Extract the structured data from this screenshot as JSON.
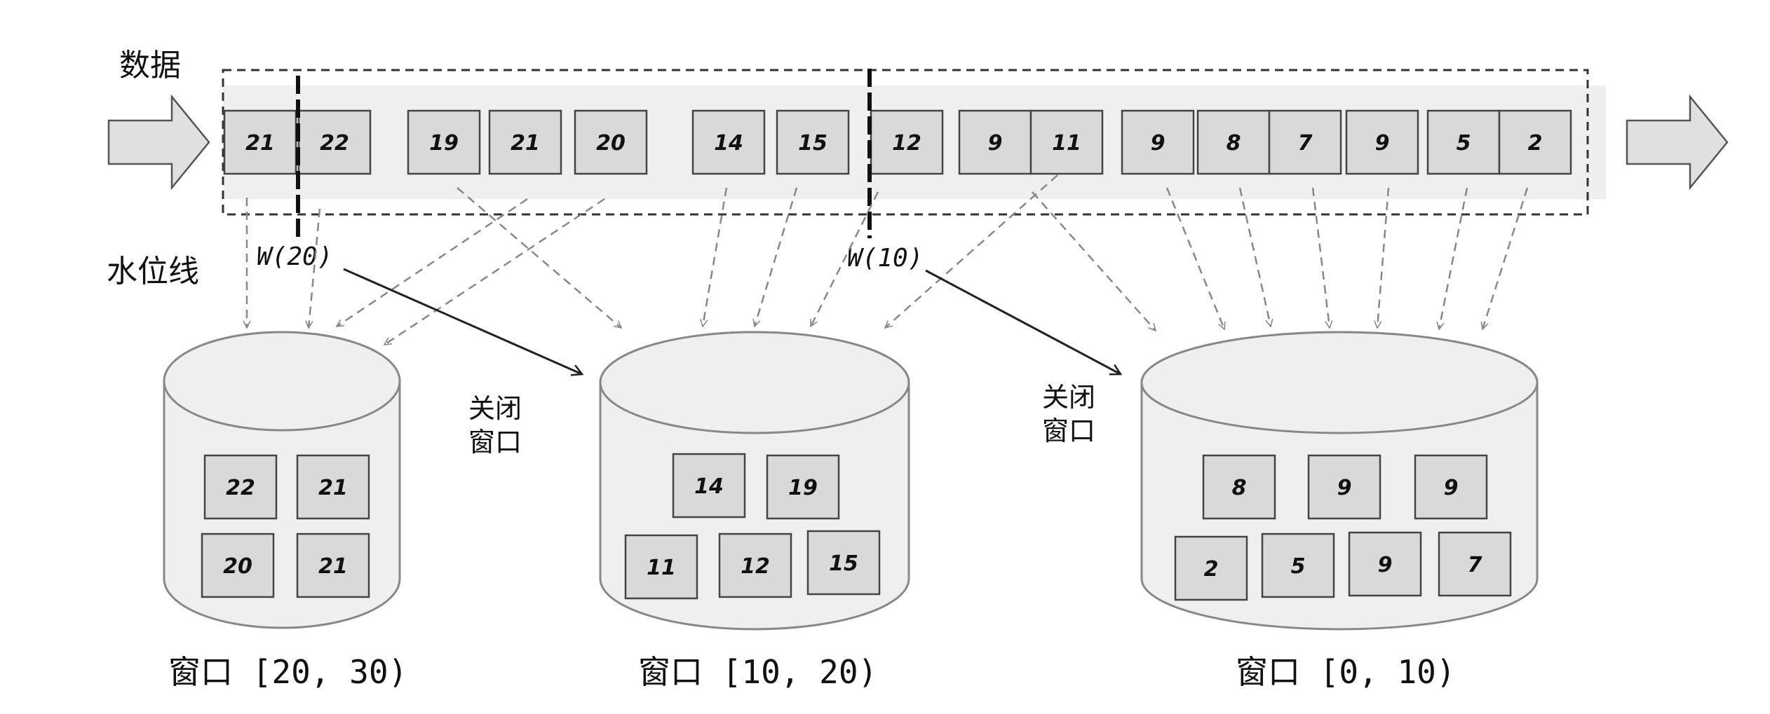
{
  "labels": {
    "data": "数据",
    "watermark": "水位线"
  },
  "stream": {
    "items": [
      "21",
      "22",
      "19",
      "21",
      "20",
      "14",
      "15",
      "12",
      "9",
      "11",
      "9",
      "8",
      "7",
      "9",
      "5",
      "2"
    ]
  },
  "watermarks": [
    {
      "text": "W(20)"
    },
    {
      "text": "W(10)"
    }
  ],
  "close_labels": [
    {
      "line1": "关闭",
      "line2": "窗口"
    },
    {
      "line1": "关闭",
      "line2": "窗口"
    }
  ],
  "windows": [
    {
      "title": "窗口 [20, 30)",
      "items": [
        "22",
        "21",
        "20",
        "21"
      ]
    },
    {
      "title": "窗口 [10, 20)",
      "items": [
        "14",
        "19",
        "11",
        "12",
        "15"
      ]
    },
    {
      "title": "窗口 [0, 10)",
      "items": [
        "8",
        "9",
        "9",
        "2",
        "5",
        "9",
        "7"
      ]
    }
  ]
}
